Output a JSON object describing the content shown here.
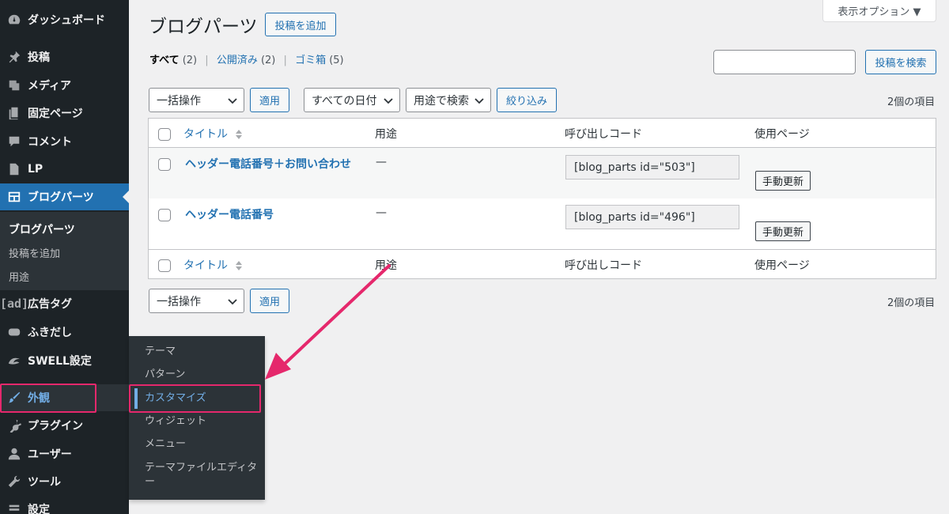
{
  "sidebar": {
    "items": [
      {
        "label": "ダッシュボード",
        "icon": "dashboard-icon"
      },
      {
        "label": "投稿",
        "icon": "pin-icon"
      },
      {
        "label": "メディア",
        "icon": "media-icon"
      },
      {
        "label": "固定ページ",
        "icon": "page-icon"
      },
      {
        "label": "コメント",
        "icon": "comment-icon"
      },
      {
        "label": "LP",
        "icon": "document-icon"
      },
      {
        "label": "ブログパーツ",
        "icon": "blog-parts-icon"
      },
      {
        "label": "広告タグ",
        "icon": "ad-icon",
        "icon_text": "[ad]"
      },
      {
        "label": "ふきだし",
        "icon": "bubble-icon"
      },
      {
        "label": "SWELL設定",
        "icon": "swell-icon"
      },
      {
        "label": "外観",
        "icon": "brush-icon"
      },
      {
        "label": "プラグイン",
        "icon": "plugin-icon"
      },
      {
        "label": "ユーザー",
        "icon": "user-icon"
      },
      {
        "label": "ツール",
        "icon": "wrench-icon"
      },
      {
        "label": "設定",
        "icon": "settings-icon"
      }
    ],
    "submenu": [
      "ブログパーツ",
      "投稿を追加",
      "用途"
    ]
  },
  "flyout": {
    "items": [
      "テーマ",
      "パターン",
      "カスタマイズ",
      "ウィジェット",
      "メニュー",
      "テーマファイルエディター"
    ]
  },
  "header": {
    "title": "ブログパーツ",
    "add_new": "投稿を追加",
    "screen_options": "表示オプション ▼"
  },
  "filters": {
    "all": "すべて",
    "all_count": "(2)",
    "published": "公開済み",
    "published_count": "(2)",
    "trash": "ゴミ箱",
    "trash_count": "(5)",
    "sep": "|"
  },
  "search": {
    "button": "投稿を検索",
    "value": ""
  },
  "actions": {
    "bulk": "一括操作",
    "apply": "適用",
    "dates": "すべての日付",
    "usage_search": "用途で検索",
    "filter": "絞り込み",
    "item_count": "2個の項目"
  },
  "table": {
    "columns": [
      "タイトル",
      "用途",
      "呼び出しコード",
      "使用ページ"
    ],
    "rows": [
      {
        "title": "ヘッダー電話番号＋お問い合わせ",
        "usage": "—",
        "code": "[blog_parts id=\"503\"]",
        "button": "手動更新"
      },
      {
        "title": "ヘッダー電話番号",
        "usage": "—",
        "code": "[blog_parts id=\"496\"]",
        "button": "手動更新"
      }
    ]
  },
  "colors": {
    "accent": "#2271b1",
    "highlight": "#e5286c",
    "sidebar": "#1d2327"
  }
}
